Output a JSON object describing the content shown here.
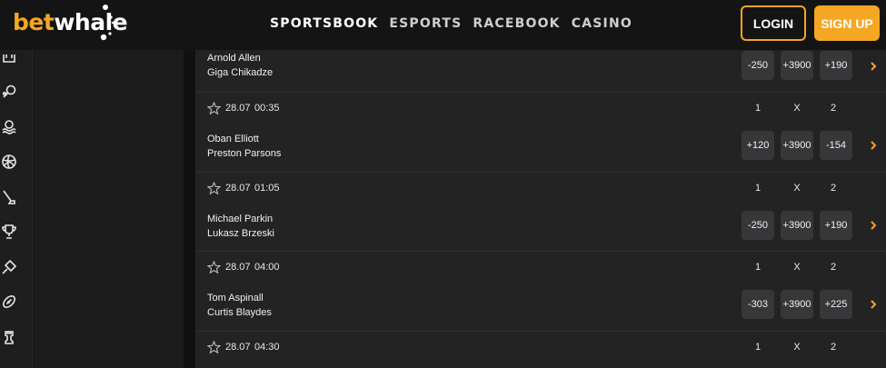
{
  "brand": {
    "logo_part1": "bet",
    "logo_part2": "whale",
    "accent": "#f5a623"
  },
  "nav": [
    "SPORTSBOOK",
    "ESPORTS",
    "RACEBOOK",
    "CASINO"
  ],
  "auth": {
    "login": "LOGIN",
    "signup": "SIGN UP"
  },
  "sidebar_icons": [
    "hockey-icon",
    "tennis-icon",
    "water-polo-icon",
    "volleyball-icon",
    "golf-icon",
    "trophy-icon",
    "badminton-icon",
    "rugby-icon",
    "chess-icon"
  ],
  "columns": [
    "1",
    "X",
    "2"
  ],
  "events": [
    {
      "date": "",
      "time": "",
      "home": "Arnold Allen",
      "away": "Giga Chikadze",
      "odds": [
        "-250",
        "+3900",
        "+190"
      ]
    },
    {
      "date": "28.07",
      "time": "00:35",
      "home": "Oban Elliott",
      "away": "Preston Parsons",
      "odds": [
        "+120",
        "+3900",
        "-154"
      ]
    },
    {
      "date": "28.07",
      "time": "01:05",
      "home": "Michael Parkin",
      "away": "Lukasz Brzeski",
      "odds": [
        "-250",
        "+3900",
        "+190"
      ]
    },
    {
      "date": "28.07",
      "time": "04:00",
      "home": "Tom Aspinall",
      "away": "Curtis Blaydes",
      "odds": [
        "-303",
        "+3900",
        "+225"
      ]
    },
    {
      "date": "28.07",
      "time": "04:30",
      "home": "",
      "away": "",
      "odds": []
    }
  ]
}
